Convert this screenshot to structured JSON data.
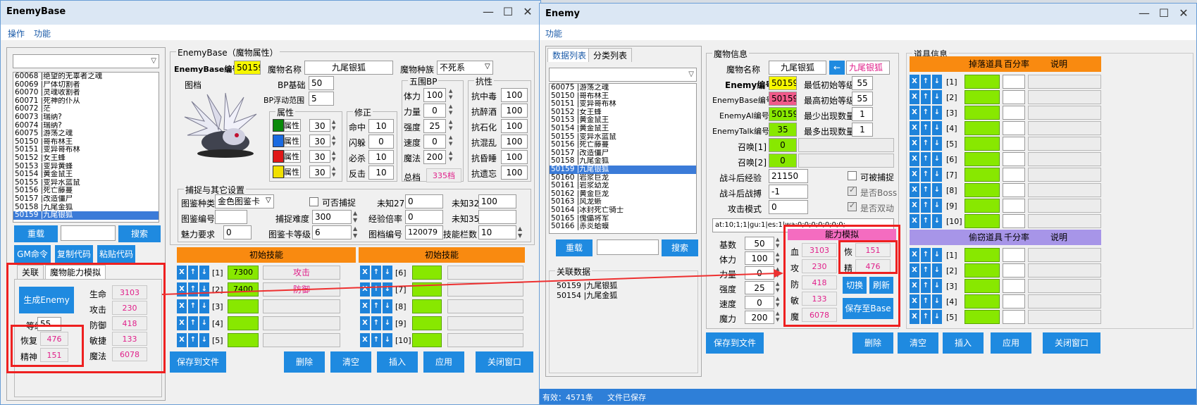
{
  "left": {
    "title": "EnemyBase",
    "menu": [
      "操作",
      "功能"
    ],
    "list": [
      "60068 |绝望的无辜者之魂",
      "60069 |尸体切割者",
      "60070 |灵魂收割者",
      "60071 |死神的仆从",
      "60072 |茫",
      "60073 |瑞纳?",
      "60074 |瑞纳?",
      "60075 |游荡之魂",
      "50150 |哥布林王",
      "50151 |变异哥布林",
      "50152 |女王蜂",
      "50153 |变异黄蜂",
      "50154 |黄金鼠王",
      "50155 |变异水蓝鼠",
      "50156 |死亡藤蔓",
      "50157 |改造僵尸",
      "50158 |九尾金狐",
      "50159 |九尾银狐"
    ],
    "btn_reload": "重载",
    "btn_search": "搜索",
    "btn_gm": "GM命令",
    "btn_copy": "复制代码",
    "btn_paste": "粘贴代码",
    "tab_rel": "关联",
    "tab_sim": "魔物能力模拟",
    "btn_gen": "生成Enemy",
    "lbl_level": "等级",
    "level": "55",
    "lbl_recover": "恢复",
    "recover": "476",
    "lbl_spirit": "精神",
    "spirit": "151",
    "lbl_life": "生命",
    "life": "3103",
    "lbl_atk": "攻击",
    "atk": "230",
    "lbl_def": "防御",
    "def": "418",
    "lbl_agi": "敏捷",
    "agi": "133",
    "lbl_mag": "魔法",
    "mag": "6078",
    "grp_title": "EnemyBase（魔物属性）",
    "lbl_id": "EnemyBase编号",
    "id": "50159",
    "lbl_name": "魔物名称",
    "name": "九尾银狐",
    "lbl_race": "魔物种族",
    "race": "不死系",
    "lbl_pic": "图档",
    "lbl_bpbase": "BP基础",
    "bpbase": "50",
    "lbl_bpfloat": "BP浮动范围",
    "bpfloat": "5",
    "grp_attr": "属性",
    "attrs": [
      {
        "label": "地属性",
        "value": "30",
        "color": "#0a8a0a"
      },
      {
        "label": "水属性",
        "value": "30",
        "color": "#1a6ae0"
      },
      {
        "label": "火属性",
        "value": "30",
        "color": "#e01818"
      },
      {
        "label": "风属性",
        "value": "30",
        "color": "#f0e000"
      }
    ],
    "grp_fix": "修正",
    "fix": [
      {
        "label": "命中",
        "value": "10"
      },
      {
        "label": "闪躲",
        "value": "0"
      },
      {
        "label": "必杀",
        "value": "10"
      },
      {
        "label": "反击",
        "value": "10"
      }
    ],
    "grp_bp": "五围BP",
    "bp": [
      {
        "label": "体力",
        "value": "100"
      },
      {
        "label": "力量",
        "value": "0"
      },
      {
        "label": "强度",
        "value": "25"
      },
      {
        "label": "速度",
        "value": "0"
      },
      {
        "label": "魔法",
        "value": "200"
      }
    ],
    "lbl_total": "总档",
    "total": "335档",
    "grp_resist": "抗性",
    "resist": [
      {
        "label": "抗中毒",
        "value": "100"
      },
      {
        "label": "抗醉酒",
        "value": "100"
      },
      {
        "label": "抗石化",
        "value": "100"
      },
      {
        "label": "抗混乱",
        "value": "100"
      },
      {
        "label": "抗昏睡",
        "value": "100"
      },
      {
        "label": "抗遗忘",
        "value": "100"
      }
    ],
    "grp_capture": "捕捉与其它设置",
    "lbl_cardtype": "图鉴种类",
    "cardtype": "金色图鉴卡",
    "lbl_cancatch": "可否捕捉",
    "lbl_u27": "未知27",
    "u27": "0",
    "lbl_u32": "未知32",
    "u32": "100",
    "lbl_cardno": "图鉴编号",
    "cardno": "",
    "lbl_catchdiff": "捕捉难度",
    "catchdiff": "300",
    "lbl_exprate": "经验倍率",
    "exprate": "0",
    "lbl_u35": "未知35",
    "u35": "",
    "lbl_charm": "魅力要求",
    "charm": "0",
    "lbl_cardlv": "图鉴卡等级",
    "cardlv": "6",
    "lbl_picno": "图档编号",
    "picno": "120079",
    "lbl_skillslots": "技能栏数",
    "skillslots": "10",
    "skill_header": "初始技能",
    "skills_left": [
      {
        "idx": "[1]",
        "code": "7300",
        "name": "攻击"
      },
      {
        "idx": "[2]",
        "code": "7400",
        "name": "防御"
      },
      {
        "idx": "[3]",
        "code": "",
        "name": ""
      },
      {
        "idx": "[4]",
        "code": "",
        "name": ""
      },
      {
        "idx": "[5]",
        "code": "",
        "name": ""
      }
    ],
    "skills_right": [
      {
        "idx": "[6]"
      },
      {
        "idx": "[7]"
      },
      {
        "idx": "[8]"
      },
      {
        "idx": "[9]"
      },
      {
        "idx": "[10]"
      }
    ],
    "btn_savefile": "保存到文件",
    "btn_del": "删除",
    "btn_clear": "清空",
    "btn_insert": "插入",
    "btn_apply": "应用",
    "btn_close": "关闭窗口"
  },
  "right": {
    "title": "Enemy",
    "menu": [
      "功能"
    ],
    "tab_data": "数据列表",
    "tab_cat": "分类列表",
    "list": [
      "60075 |游荡之魂",
      "50150 |哥布林王",
      "50151 |变异哥布林",
      "50152 |女王蜂",
      "50153 |黄金鼠王",
      "50154 |黄金鼠王",
      "50155 |变异水蓝鼠",
      "50156 |死亡藤蔓",
      "50157 |改造僵尸",
      "50158 |九尾金狐",
      "50159 |九尾银狐",
      "50160 |岩浆巨龙",
      "50161 |岩浆幼龙",
      "50162 |黄金巨龙",
      "50163 |风龙蜥",
      "50164 |冰封死亡骑士",
      "50165 |傀儡将军",
      "50166 |赤炎蛤蟆"
    ],
    "btn_reload": "重载",
    "btn_search": "搜索",
    "grp_rel": "关联数据",
    "rel_items": [
      "50159 |九尾银狐",
      "50154 |九尾金狐"
    ],
    "grp_info": "魔物信息",
    "lbl_name": "魔物名称",
    "name": "九尾银狐",
    "base_name": "九尾银狐",
    "arrow": "←",
    "lbl_enemyid": "Enemy编号",
    "enemyid": "50159",
    "lbl_minlv": "最低初始等级",
    "minlv": "55",
    "lbl_baseid": "EnemyBase编号",
    "baseid": "50159",
    "lbl_maxlv": "最高初始等级",
    "maxlv": "55",
    "lbl_aiid": "EnemyAI编号",
    "aiid": "50159",
    "lbl_mincnt": "最少出现数量",
    "mincnt": "1",
    "lbl_talkid": "EnemyTalk编号",
    "talkid": "35",
    "lbl_maxcnt": "最多出现数量",
    "maxcnt": "1",
    "lbl_summon1": "召唤[1]",
    "summon1": "0",
    "lbl_summon2": "召唤[2]",
    "summon2": "0",
    "lbl_exp": "战斗后经验",
    "exp": "21150",
    "lbl_catch": "可被捕捉",
    "lbl_afterbattle": "战斗后战搏",
    "afterbattle": "-1",
    "lbl_boss": "是否Boss",
    "lbl_atkmode": "攻击模式",
    "atkmode": "0",
    "lbl_double": "是否双动",
    "code": "at:10;1;1|gu:1|es:1|wa:0;0;0;0;0;0;0;",
    "bp": [
      {
        "label": "基数",
        "value": "50"
      },
      {
        "label": "体力",
        "value": "100"
      },
      {
        "label": "力量",
        "value": "0"
      },
      {
        "label": "强度",
        "value": "25"
      },
      {
        "label": "速度",
        "value": "0"
      },
      {
        "label": "魔力",
        "value": "200"
      }
    ],
    "sim_header": "能力模拟",
    "sim": [
      {
        "label": "血",
        "value": "3103"
      },
      {
        "label": "攻",
        "value": "230"
      },
      {
        "label": "防",
        "value": "418"
      },
      {
        "label": "敏",
        "value": "133"
      },
      {
        "label": "魔",
        "value": "6078"
      }
    ],
    "lbl_recover": "恢",
    "recover": "151",
    "lbl_spirit": "精",
    "spirit": "476",
    "btn_switch": "切换",
    "btn_refresh": "刷新",
    "btn_savebase": "保存至Base",
    "grp_items": "道具信息",
    "drop_header": "掉落道具",
    "drop_pct": "百分率",
    "drop_desc": "说明",
    "drops": [
      "[1]",
      "[2]",
      "[3]",
      "[4]",
      "[5]",
      "[6]",
      "[7]",
      "[8]",
      "[9]",
      "[10]"
    ],
    "steal_header": "偷窃道具",
    "steal_pct": "千分率",
    "steal_desc": "说明",
    "steals": [
      "[1]",
      "[2]",
      "[3]",
      "[4]",
      "[5]"
    ],
    "btn_savefile": "保存到文件",
    "btn_del": "删除",
    "btn_clear": "清空",
    "btn_insert": "插入",
    "btn_apply": "应用",
    "btn_close": "关闭窗口",
    "status_valid": "有效：4571条",
    "status_saved": "文件已保存"
  }
}
